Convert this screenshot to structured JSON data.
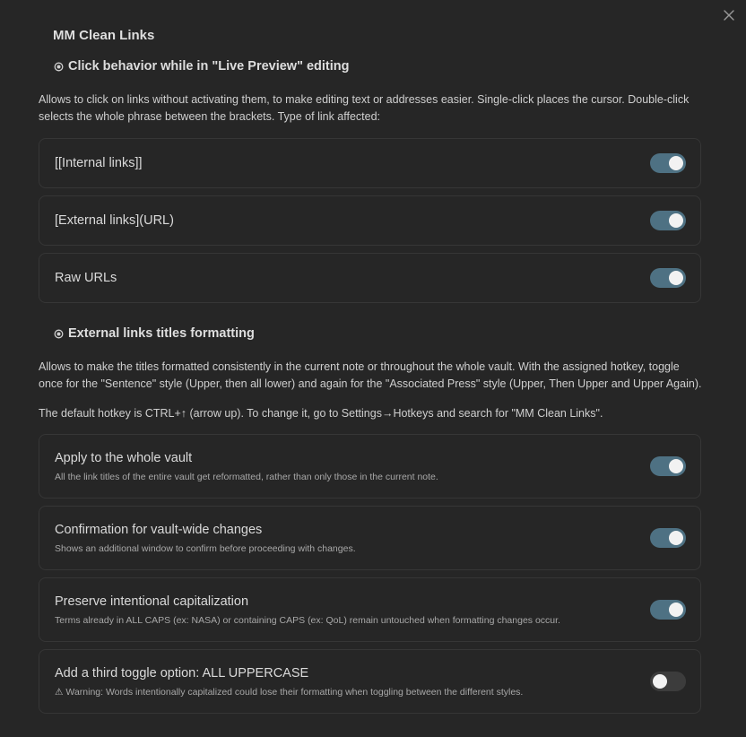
{
  "modal": {
    "title": "MM Clean Links",
    "close_icon": "close-icon"
  },
  "sections": [
    {
      "heading": "Click behavior while in \"Live Preview\" editing",
      "description": "Allows to click on links without activating them, to make editing text or addresses easier. Single-click places the cursor. Double-click selects the whole phrase between the brackets. Type of link affected:",
      "settings": [
        {
          "name": "[[Internal links]]",
          "enabled": true
        },
        {
          "name": "[External links](URL)",
          "enabled": true
        },
        {
          "name": "Raw URLs",
          "enabled": true
        }
      ]
    },
    {
      "heading": "External links titles formatting",
      "description": "Allows to make the titles formatted consistently in the current note or throughout the whole vault. With the assigned hotkey, toggle once for the \"Sentence\" style (Upper, then all lower) and again for the \"Associated Press\" style (Upper, Then Upper and Upper Again).",
      "description2": "The default hotkey is CTRL+↑ (arrow up). To change it, go to Settings→Hotkeys and search for \"MM Clean Links\".",
      "settings": [
        {
          "name": "Apply to the whole vault",
          "desc": "All the link titles of the entire vault get reformatted, rather than only those in the current note.",
          "enabled": true
        },
        {
          "name": "Confirmation for vault-wide changes",
          "desc": "Shows an additional window to confirm before proceeding with changes.",
          "enabled": true
        },
        {
          "name": "Preserve intentional capitalization",
          "desc": "Terms already in ALL CAPS (ex: NASA) or containing CAPS (ex: QoL) remain untouched when formatting changes occur.",
          "enabled": true
        },
        {
          "name": "Add a third toggle option: ALL UPPERCASE",
          "desc": "Warning: Words intentionally capitalized could lose their formatting when toggling between the different styles.",
          "warning_icon": "⚠",
          "enabled": false
        }
      ]
    }
  ],
  "colors": {
    "background": "#262626",
    "toggle_on": "#4e7183",
    "toggle_off": "#3c3c3c",
    "card_border": "#363636"
  }
}
